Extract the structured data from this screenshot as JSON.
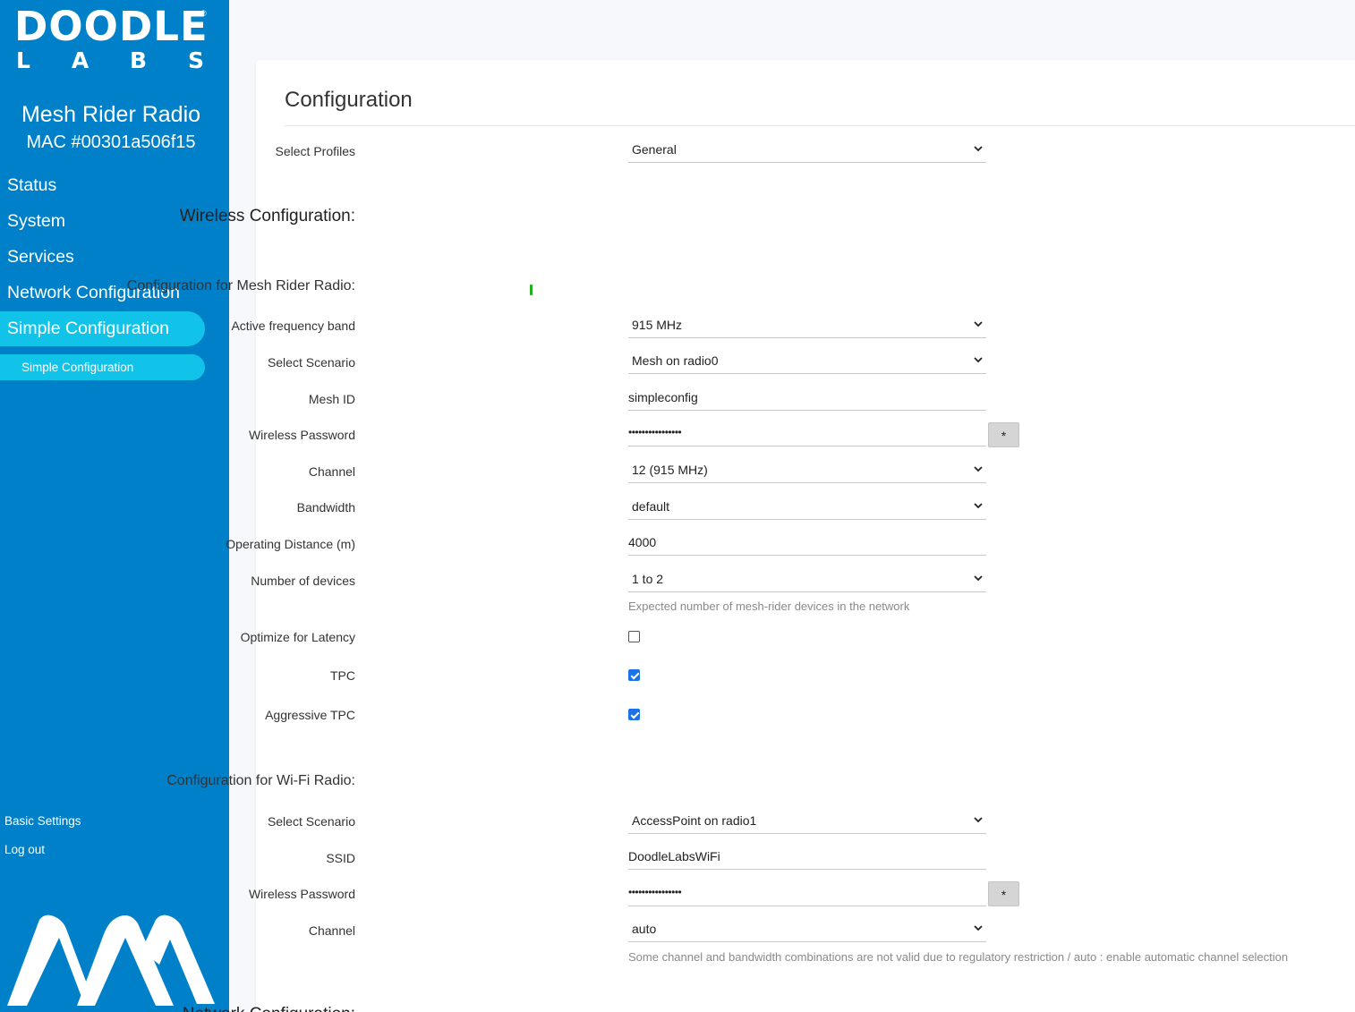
{
  "brand": {
    "logo_main": "DOODLE",
    "logo_sub": [
      "L",
      "A",
      "B",
      "S"
    ],
    "registered": "®"
  },
  "device": {
    "title": "Mesh Rider Radio",
    "mac": "MAC #00301a506f15"
  },
  "nav": {
    "items": [
      "Status",
      "System",
      "Services",
      "Network Configuration"
    ],
    "active": "Simple Configuration",
    "sub_active": "Simple Configuration",
    "bottom": [
      "Basic Settings",
      "Log out"
    ]
  },
  "page": {
    "title": "Configuration",
    "select_profiles_label": "Select Profiles",
    "select_profiles_value": "General",
    "wireless_heading": "Wireless Configuration:",
    "mesh_heading": "Configuration for Mesh Rider Radio:",
    "wifi_heading": "Configuration for Wi-Fi Radio:",
    "network_heading": "Network Configuration:"
  },
  "mesh": {
    "freq_label": "Active frequency band",
    "freq_value": "915 MHz",
    "scenario_label": "Select Scenario",
    "scenario_value": "Mesh on radio0",
    "meshid_label": "Mesh ID",
    "meshid_value": "simpleconfig",
    "password_label": "Wireless Password",
    "password_value": "••••••••••••••••",
    "channel_label": "Channel",
    "channel_value": "12 (915 MHz)",
    "bandwidth_label": "Bandwidth",
    "bandwidth_value": "default",
    "distance_label": "Operating Distance (m)",
    "distance_value": "4000",
    "devices_label": "Number of devices",
    "devices_value": "1 to 2",
    "devices_hint": "Expected number of mesh-rider devices in the network",
    "latency_label": "Optimize for Latency",
    "latency_checked": false,
    "tpc_label": "TPC",
    "tpc_checked": true,
    "aggressive_label": "Aggressive TPC",
    "aggressive_checked": true
  },
  "wifi": {
    "scenario_label": "Select Scenario",
    "scenario_value": "AccessPoint on radio1",
    "ssid_label": "SSID",
    "ssid_value": "DoodleLabsWiFi",
    "password_label": "Wireless Password",
    "password_value": "••••••••••••••••",
    "channel_label": "Channel",
    "channel_value": "auto",
    "channel_hint": "Some channel and bandwidth combinations are not valid due to regulatory restriction / auto : enable automatic channel selection"
  },
  "reveal_button": "*"
}
